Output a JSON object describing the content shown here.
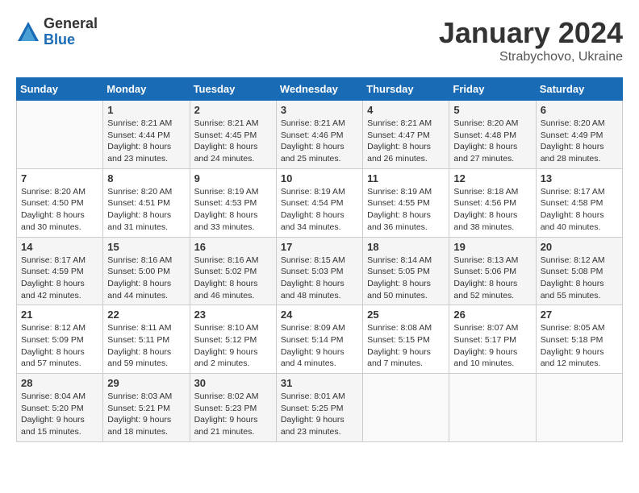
{
  "logo": {
    "general": "General",
    "blue": "Blue"
  },
  "title": {
    "month": "January 2024",
    "location": "Strabychovo, Ukraine"
  },
  "headers": [
    "Sunday",
    "Monday",
    "Tuesday",
    "Wednesday",
    "Thursday",
    "Friday",
    "Saturday"
  ],
  "weeks": [
    [
      {
        "day": "",
        "sunrise": "",
        "sunset": "",
        "daylight": ""
      },
      {
        "day": "1",
        "sunrise": "Sunrise: 8:21 AM",
        "sunset": "Sunset: 4:44 PM",
        "daylight": "Daylight: 8 hours and 23 minutes."
      },
      {
        "day": "2",
        "sunrise": "Sunrise: 8:21 AM",
        "sunset": "Sunset: 4:45 PM",
        "daylight": "Daylight: 8 hours and 24 minutes."
      },
      {
        "day": "3",
        "sunrise": "Sunrise: 8:21 AM",
        "sunset": "Sunset: 4:46 PM",
        "daylight": "Daylight: 8 hours and 25 minutes."
      },
      {
        "day": "4",
        "sunrise": "Sunrise: 8:21 AM",
        "sunset": "Sunset: 4:47 PM",
        "daylight": "Daylight: 8 hours and 26 minutes."
      },
      {
        "day": "5",
        "sunrise": "Sunrise: 8:20 AM",
        "sunset": "Sunset: 4:48 PM",
        "daylight": "Daylight: 8 hours and 27 minutes."
      },
      {
        "day": "6",
        "sunrise": "Sunrise: 8:20 AM",
        "sunset": "Sunset: 4:49 PM",
        "daylight": "Daylight: 8 hours and 28 minutes."
      }
    ],
    [
      {
        "day": "7",
        "sunrise": "Sunrise: 8:20 AM",
        "sunset": "Sunset: 4:50 PM",
        "daylight": "Daylight: 8 hours and 30 minutes."
      },
      {
        "day": "8",
        "sunrise": "Sunrise: 8:20 AM",
        "sunset": "Sunset: 4:51 PM",
        "daylight": "Daylight: 8 hours and 31 minutes."
      },
      {
        "day": "9",
        "sunrise": "Sunrise: 8:19 AM",
        "sunset": "Sunset: 4:53 PM",
        "daylight": "Daylight: 8 hours and 33 minutes."
      },
      {
        "day": "10",
        "sunrise": "Sunrise: 8:19 AM",
        "sunset": "Sunset: 4:54 PM",
        "daylight": "Daylight: 8 hours and 34 minutes."
      },
      {
        "day": "11",
        "sunrise": "Sunrise: 8:19 AM",
        "sunset": "Sunset: 4:55 PM",
        "daylight": "Daylight: 8 hours and 36 minutes."
      },
      {
        "day": "12",
        "sunrise": "Sunrise: 8:18 AM",
        "sunset": "Sunset: 4:56 PM",
        "daylight": "Daylight: 8 hours and 38 minutes."
      },
      {
        "day": "13",
        "sunrise": "Sunrise: 8:17 AM",
        "sunset": "Sunset: 4:58 PM",
        "daylight": "Daylight: 8 hours and 40 minutes."
      }
    ],
    [
      {
        "day": "14",
        "sunrise": "Sunrise: 8:17 AM",
        "sunset": "Sunset: 4:59 PM",
        "daylight": "Daylight: 8 hours and 42 minutes."
      },
      {
        "day": "15",
        "sunrise": "Sunrise: 8:16 AM",
        "sunset": "Sunset: 5:00 PM",
        "daylight": "Daylight: 8 hours and 44 minutes."
      },
      {
        "day": "16",
        "sunrise": "Sunrise: 8:16 AM",
        "sunset": "Sunset: 5:02 PM",
        "daylight": "Daylight: 8 hours and 46 minutes."
      },
      {
        "day": "17",
        "sunrise": "Sunrise: 8:15 AM",
        "sunset": "Sunset: 5:03 PM",
        "daylight": "Daylight: 8 hours and 48 minutes."
      },
      {
        "day": "18",
        "sunrise": "Sunrise: 8:14 AM",
        "sunset": "Sunset: 5:05 PM",
        "daylight": "Daylight: 8 hours and 50 minutes."
      },
      {
        "day": "19",
        "sunrise": "Sunrise: 8:13 AM",
        "sunset": "Sunset: 5:06 PM",
        "daylight": "Daylight: 8 hours and 52 minutes."
      },
      {
        "day": "20",
        "sunrise": "Sunrise: 8:12 AM",
        "sunset": "Sunset: 5:08 PM",
        "daylight": "Daylight: 8 hours and 55 minutes."
      }
    ],
    [
      {
        "day": "21",
        "sunrise": "Sunrise: 8:12 AM",
        "sunset": "Sunset: 5:09 PM",
        "daylight": "Daylight: 8 hours and 57 minutes."
      },
      {
        "day": "22",
        "sunrise": "Sunrise: 8:11 AM",
        "sunset": "Sunset: 5:11 PM",
        "daylight": "Daylight: 8 hours and 59 minutes."
      },
      {
        "day": "23",
        "sunrise": "Sunrise: 8:10 AM",
        "sunset": "Sunset: 5:12 PM",
        "daylight": "Daylight: 9 hours and 2 minutes."
      },
      {
        "day": "24",
        "sunrise": "Sunrise: 8:09 AM",
        "sunset": "Sunset: 5:14 PM",
        "daylight": "Daylight: 9 hours and 4 minutes."
      },
      {
        "day": "25",
        "sunrise": "Sunrise: 8:08 AM",
        "sunset": "Sunset: 5:15 PM",
        "daylight": "Daylight: 9 hours and 7 minutes."
      },
      {
        "day": "26",
        "sunrise": "Sunrise: 8:07 AM",
        "sunset": "Sunset: 5:17 PM",
        "daylight": "Daylight: 9 hours and 10 minutes."
      },
      {
        "day": "27",
        "sunrise": "Sunrise: 8:05 AM",
        "sunset": "Sunset: 5:18 PM",
        "daylight": "Daylight: 9 hours and 12 minutes."
      }
    ],
    [
      {
        "day": "28",
        "sunrise": "Sunrise: 8:04 AM",
        "sunset": "Sunset: 5:20 PM",
        "daylight": "Daylight: 9 hours and 15 minutes."
      },
      {
        "day": "29",
        "sunrise": "Sunrise: 8:03 AM",
        "sunset": "Sunset: 5:21 PM",
        "daylight": "Daylight: 9 hours and 18 minutes."
      },
      {
        "day": "30",
        "sunrise": "Sunrise: 8:02 AM",
        "sunset": "Sunset: 5:23 PM",
        "daylight": "Daylight: 9 hours and 21 minutes."
      },
      {
        "day": "31",
        "sunrise": "Sunrise: 8:01 AM",
        "sunset": "Sunset: 5:25 PM",
        "daylight": "Daylight: 9 hours and 23 minutes."
      },
      {
        "day": "",
        "sunrise": "",
        "sunset": "",
        "daylight": ""
      },
      {
        "day": "",
        "sunrise": "",
        "sunset": "",
        "daylight": ""
      },
      {
        "day": "",
        "sunrise": "",
        "sunset": "",
        "daylight": ""
      }
    ]
  ]
}
